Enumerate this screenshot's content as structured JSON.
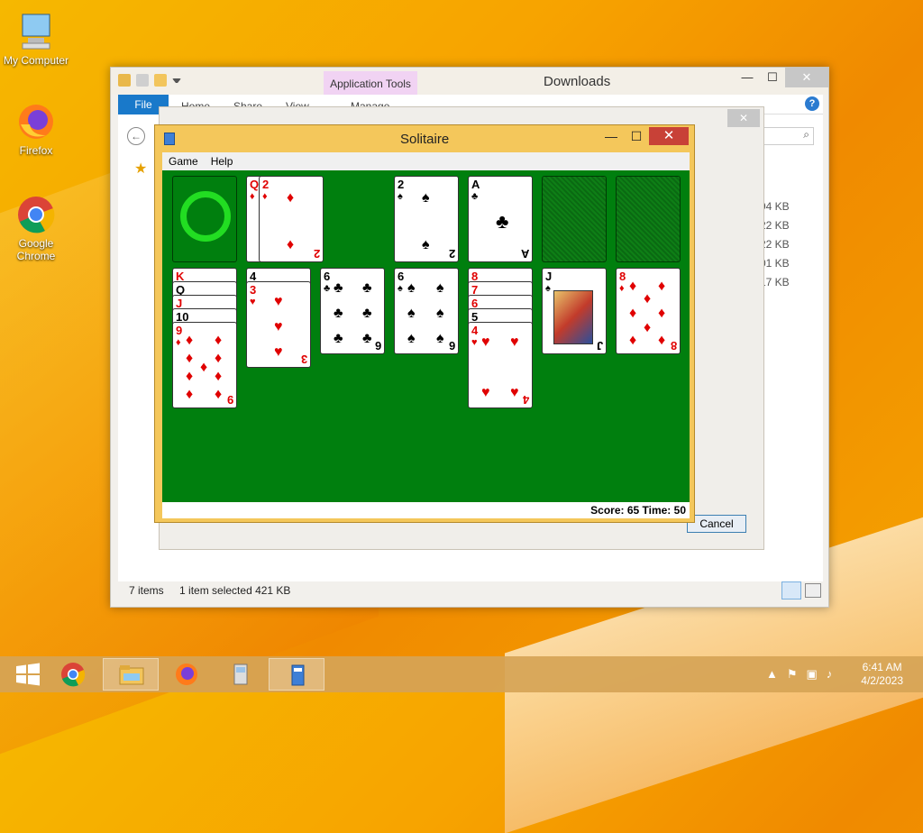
{
  "desktop": {
    "icons": [
      {
        "label": "My Computer"
      },
      {
        "label": "Firefox"
      },
      {
        "label": "Google Chrome"
      }
    ]
  },
  "explorer": {
    "title": "Downloads",
    "context_tab": "Application Tools",
    "ribbon_tabs": [
      "File",
      "Home",
      "Share",
      "View",
      "Manage"
    ],
    "file_sizes": [
      "94 KB",
      "22 KB",
      "22 KB",
      "01 KB",
      "17 KB"
    ],
    "status": {
      "items": "7 items",
      "selected": "1 item selected  421 KB"
    },
    "cancel_label": "Cancel"
  },
  "solitaire": {
    "title": "Solitaire",
    "menu": [
      "Game",
      "Help"
    ],
    "score_text": "Score: 65 Time: 50",
    "colors": {
      "felt": "#007f0e",
      "red": "#e00000",
      "black": "#000000",
      "frame": "#f4c75b"
    },
    "stock_symbol": "ring",
    "waste": [
      {
        "rank": "Q",
        "suit": "♦"
      },
      {
        "rank": "2",
        "suit": "♦"
      }
    ],
    "foundations": [
      {
        "rank": "2",
        "suit": "♠"
      },
      {
        "rank": "A",
        "suit": "♣"
      },
      {
        "rank": "",
        "suit": ""
      },
      {
        "rank": "",
        "suit": ""
      }
    ],
    "tableau": [
      [
        {
          "rank": "K",
          "suit": "♦"
        },
        {
          "rank": "Q",
          "suit": "♣"
        },
        {
          "rank": "J",
          "suit": "♦"
        },
        {
          "rank": "10",
          "suit": "♠"
        },
        {
          "rank": "9",
          "suit": "♦"
        }
      ],
      [
        {
          "rank": "4",
          "suit": "♠"
        },
        {
          "rank": "3",
          "suit": "♥"
        }
      ],
      [
        {
          "rank": "6",
          "suit": "♣"
        }
      ],
      [
        {
          "rank": "6",
          "suit": "♠"
        }
      ],
      [
        {
          "rank": "8",
          "suit": "♦"
        },
        {
          "rank": "7",
          "suit": "♥"
        },
        {
          "rank": "6",
          "suit": "♦"
        },
        {
          "rank": "5",
          "suit": "♠"
        },
        {
          "rank": "4",
          "suit": "♥"
        }
      ],
      [
        {
          "rank": "J",
          "suit": "♠"
        }
      ],
      [
        {
          "rank": "8",
          "suit": "♦"
        }
      ]
    ]
  },
  "taskbar": {
    "time": "6:41 AM",
    "date": "4/2/2023",
    "apps": [
      "start",
      "chrome",
      "file-explorer",
      "firefox",
      "recycle-app",
      "solitaire"
    ]
  }
}
